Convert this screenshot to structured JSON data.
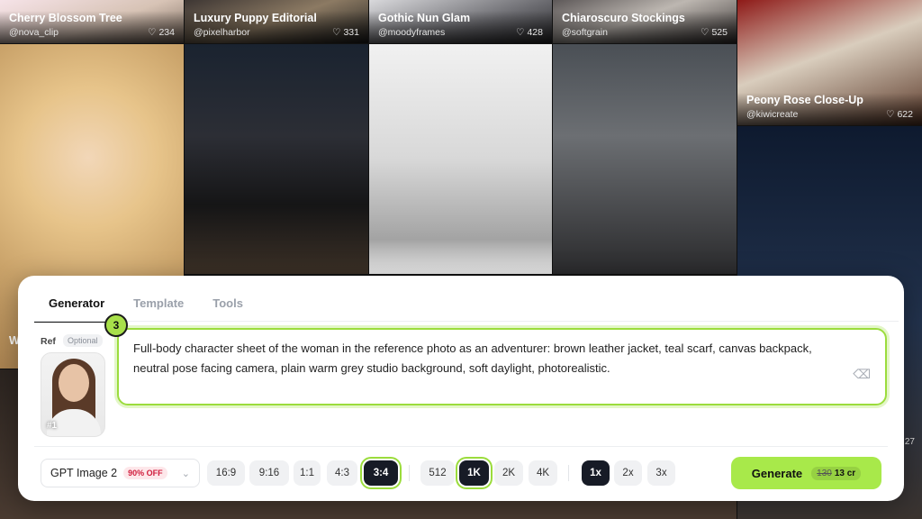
{
  "gallery": {
    "tiles": [
      {
        "title": "Cherry Blossom Tree",
        "author": "@nova_clip",
        "likes": "234"
      },
      {
        "title": "Luxury Puppy Editorial",
        "author": "@pixelharbor",
        "likes": "331"
      },
      {
        "title": "Gothic Nun Glam",
        "author": "@moodyframes",
        "likes": "428"
      },
      {
        "title": "Chiaroscuro Stockings",
        "author": "@softgrain",
        "likes": "525"
      },
      {
        "title": "Peony Rose Close-Up",
        "author": "@kiwicreate",
        "likes": "622"
      }
    ],
    "partial_left_letter": "W",
    "partial_right_likes": "27"
  },
  "panel": {
    "tabs": [
      "Generator",
      "Template",
      "Tools"
    ],
    "active_tab": "Generator",
    "ref_label": "Ref",
    "ref_optional": "Optional",
    "ref_image_number": "#1",
    "step_number": "3",
    "prompt_text": "Full-body character sheet of the woman in the reference photo as an adventurer: brown leather jacket, teal scarf, canvas backpack, neutral pose facing camera, plain warm grey studio background, soft daylight, photorealistic.",
    "model": {
      "name": "GPT Image 2",
      "badge": "90% OFF"
    },
    "aspect_ratios": [
      "16:9",
      "9:16",
      "1:1",
      "4:3",
      "3:4"
    ],
    "selected_aspect": "3:4",
    "resolutions": [
      "512",
      "1K",
      "2K",
      "4K"
    ],
    "selected_resolution": "1K",
    "counts": [
      "1x",
      "2x",
      "3x"
    ],
    "selected_count": "1x",
    "generate": {
      "label": "Generate",
      "old_cost": "130",
      "new_cost": "13 cr"
    },
    "accent_color": "#a8e94a"
  }
}
